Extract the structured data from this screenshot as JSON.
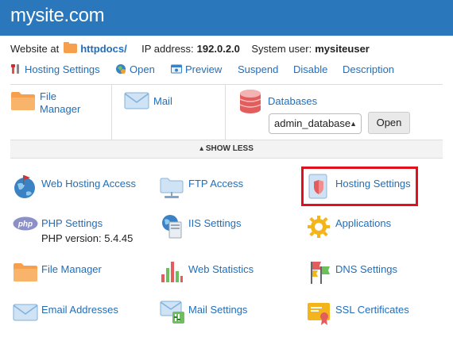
{
  "site": {
    "title": "mysite.com"
  },
  "info": {
    "website_at_label": "Website at",
    "folder": "httpdocs/",
    "ip_label": "IP address:",
    "ip": "192.0.2.0",
    "user_label": "System user:",
    "user": "mysiteuser"
  },
  "toolbar": {
    "hosting_settings": "Hosting Settings",
    "open": "Open",
    "preview": "Preview",
    "suspend": "Suspend",
    "disable": "Disable",
    "description": "Description"
  },
  "quick": {
    "file_manager_1": "File",
    "file_manager_2": "Manager",
    "mail": "Mail",
    "databases": "Databases",
    "db_select": "admin_database",
    "db_open": "Open"
  },
  "show_less": "▴ SHOW LESS",
  "grid": {
    "web_hosting_access": "Web Hosting Access",
    "ftp_access": "FTP Access",
    "hosting_settings": "Hosting Settings",
    "php_settings": "PHP Settings",
    "php_version": "PHP version: 5.4.45",
    "iis_settings": "IIS Settings",
    "applications": "Applications",
    "file_manager": "File Manager",
    "web_statistics": "Web Statistics",
    "dns_settings": "DNS Settings",
    "email_addresses": "Email Addresses",
    "mail_settings": "Mail Settings",
    "ssl_certificates": "SSL Certificates"
  },
  "colors": {
    "header": "#2a77bb",
    "link": "#1f6ebd",
    "highlight": "#e0101c",
    "folder": "#f6a04d"
  }
}
